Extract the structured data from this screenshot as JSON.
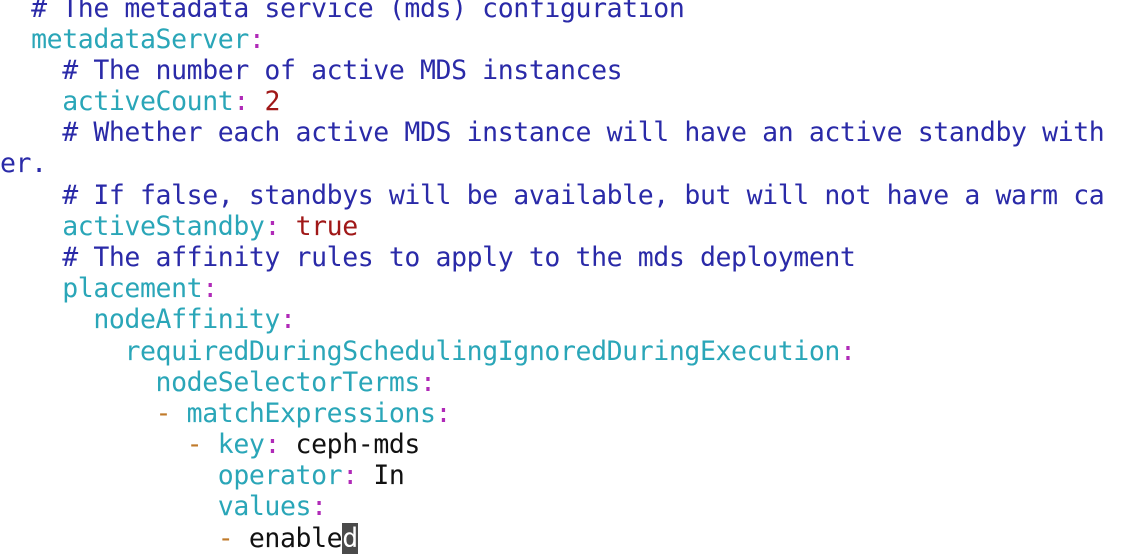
{
  "lines": [
    {
      "indent": "  ",
      "comment": "# The metadata service (mds) configuration"
    },
    {
      "indent": "  ",
      "key": "metadataServer",
      "sep": ":"
    },
    {
      "indent": "    ",
      "comment": "# The number of active MDS instances"
    },
    {
      "indent": "    ",
      "key": "activeCount",
      "sep": ":",
      "value": "2"
    },
    {
      "indent": "    ",
      "comment": "# Whether each active MDS instance will have an active standby with"
    },
    {
      "text": "er."
    },
    {
      "indent": "    ",
      "comment": "# If false, standbys will be available, but will not have a warm ca"
    },
    {
      "indent": "    ",
      "key": "activeStandby",
      "sep": ":",
      "value": "true"
    },
    {
      "indent": "    ",
      "comment": "# The affinity rules to apply to the mds deployment"
    },
    {
      "indent": "    ",
      "key": "placement",
      "sep": ":"
    },
    {
      "indent": "      ",
      "key": "nodeAffinity",
      "sep": ":"
    },
    {
      "indent": "        ",
      "key": "requiredDuringSchedulingIgnoredDuringExecution",
      "sep": ":"
    },
    {
      "indent": "          ",
      "key": "nodeSelectorTerms",
      "sep": ":"
    },
    {
      "indent": "          ",
      "dash": "- ",
      "key": "matchExpressions",
      "sep": ":"
    },
    {
      "indent": "            ",
      "dash": "- ",
      "key": "key",
      "sep": ": ",
      "value": "ceph-mds"
    },
    {
      "indent": "              ",
      "key": "operator",
      "sep": ": ",
      "value": "In"
    },
    {
      "indent": "              ",
      "key": "values",
      "sep": ":"
    },
    {
      "indent": "              ",
      "dash": "- ",
      "value": "enable",
      "cursor_char": "d"
    }
  ]
}
